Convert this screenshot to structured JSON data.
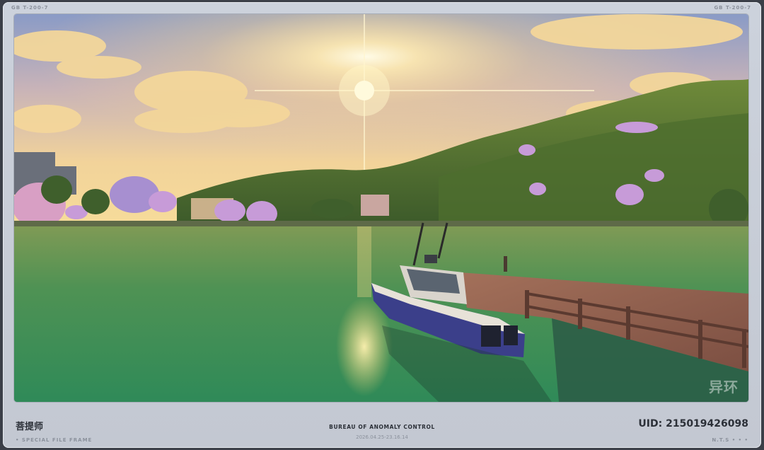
{
  "header": {
    "left_code": "GB   T-200-7",
    "right_code": "GB   T-200-7"
  },
  "scene": {
    "watermark": "异环"
  },
  "footer": {
    "name": "菩提师",
    "left_sub": "• SPECIAL FILE FRAME",
    "title": "BUREAU OF ANOMALY CONTROL",
    "date": "2026.04.25-23.16.14",
    "uid": "UID: 215019426098",
    "right_sub": "N.T.S • • •"
  },
  "colors": {
    "frame": "#c8cdd6",
    "sky_top": "#8fa0c8",
    "sun": "#fff6c8",
    "water": "#3f8e52"
  }
}
